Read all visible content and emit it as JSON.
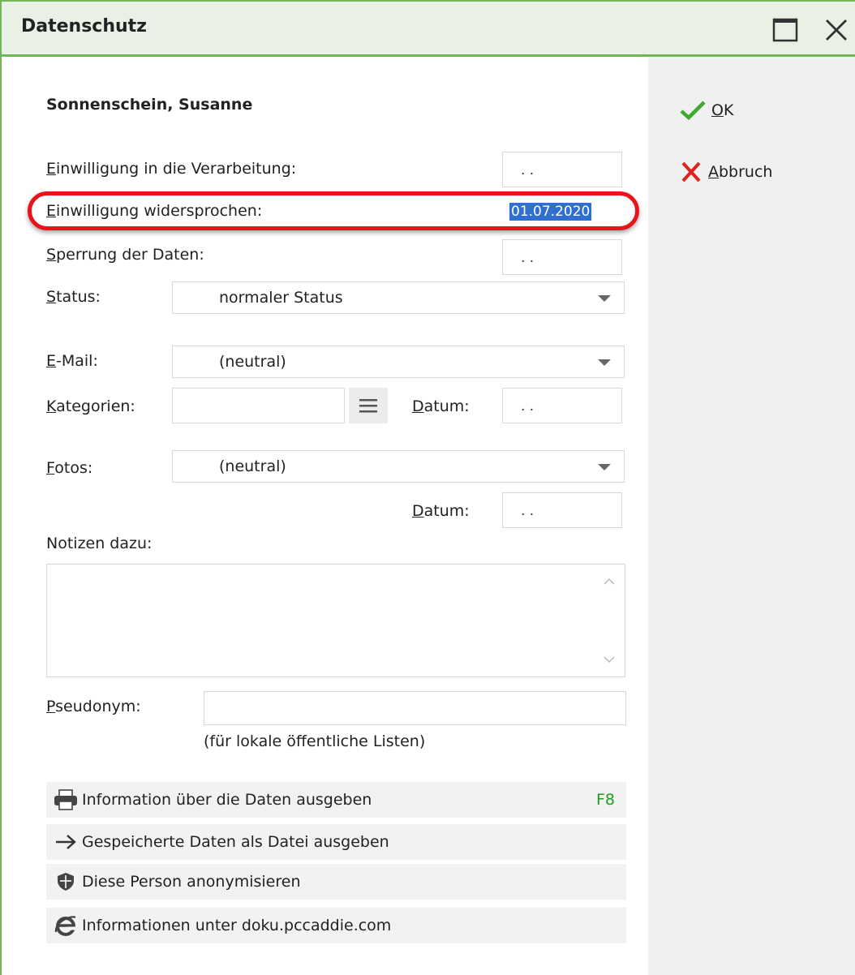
{
  "window": {
    "title": "Datenschutz"
  },
  "person": {
    "name": "Sonnenschein, Susanne"
  },
  "consent": {
    "processing_label_m": "E",
    "processing_label_rest": "inwilligung in die Verarbeitung:",
    "processing_value": ". .",
    "objected_label_m": "E",
    "objected_label_rest": "inwilligung widersprochen:",
    "objected_value": "01.07.2020",
    "blocked_label_m": "S",
    "blocked_label_rest": "perrung der Daten:",
    "blocked_value": ". ."
  },
  "status": {
    "label_m": "S",
    "label_rest": "tatus:",
    "value": "normaler Status"
  },
  "email": {
    "label_m": "E",
    "label_rest": "-Mail:",
    "value": "(neutral)"
  },
  "categories": {
    "label_m": "K",
    "label_rest": "ategorien:",
    "value": "",
    "date_label_m": "D",
    "date_label_rest": "atum:",
    "date_value": ". ."
  },
  "photos": {
    "label_m": "F",
    "label_rest": "otos:",
    "value": "(neutral)",
    "date_label_m": "D",
    "date_label_rest": "atum:",
    "date_value": ". ."
  },
  "notes": {
    "label": "Notizen dazu:",
    "value": ""
  },
  "pseudonym": {
    "label_m": "P",
    "label_rest": "seudonym:",
    "value": "",
    "hint": "(für lokale öffentliche Listen)"
  },
  "actions": [
    {
      "icon": "printer-icon",
      "label": "Information über die Daten ausgeben",
      "key": "F8"
    },
    {
      "icon": "arrow-right-icon",
      "label": "Gespeicherte Daten als Datei ausgeben",
      "key": ""
    },
    {
      "icon": "shield-icon",
      "label": "Diese Person anonymisieren",
      "key": ""
    },
    {
      "icon": "internet-explorer-icon",
      "label": "Informationen unter doku.pccaddie.com",
      "key": ""
    }
  ],
  "side": {
    "ok_m": "O",
    "ok_rest": "K",
    "abort_m": "A",
    "abort_rest": "bbruch"
  },
  "colors": {
    "accent": "#74b45a",
    "title_bg": "#e8f1e3",
    "highlight": "#e8141b",
    "selection": "#2f6fd0",
    "shortcut": "#1e9e1e"
  }
}
